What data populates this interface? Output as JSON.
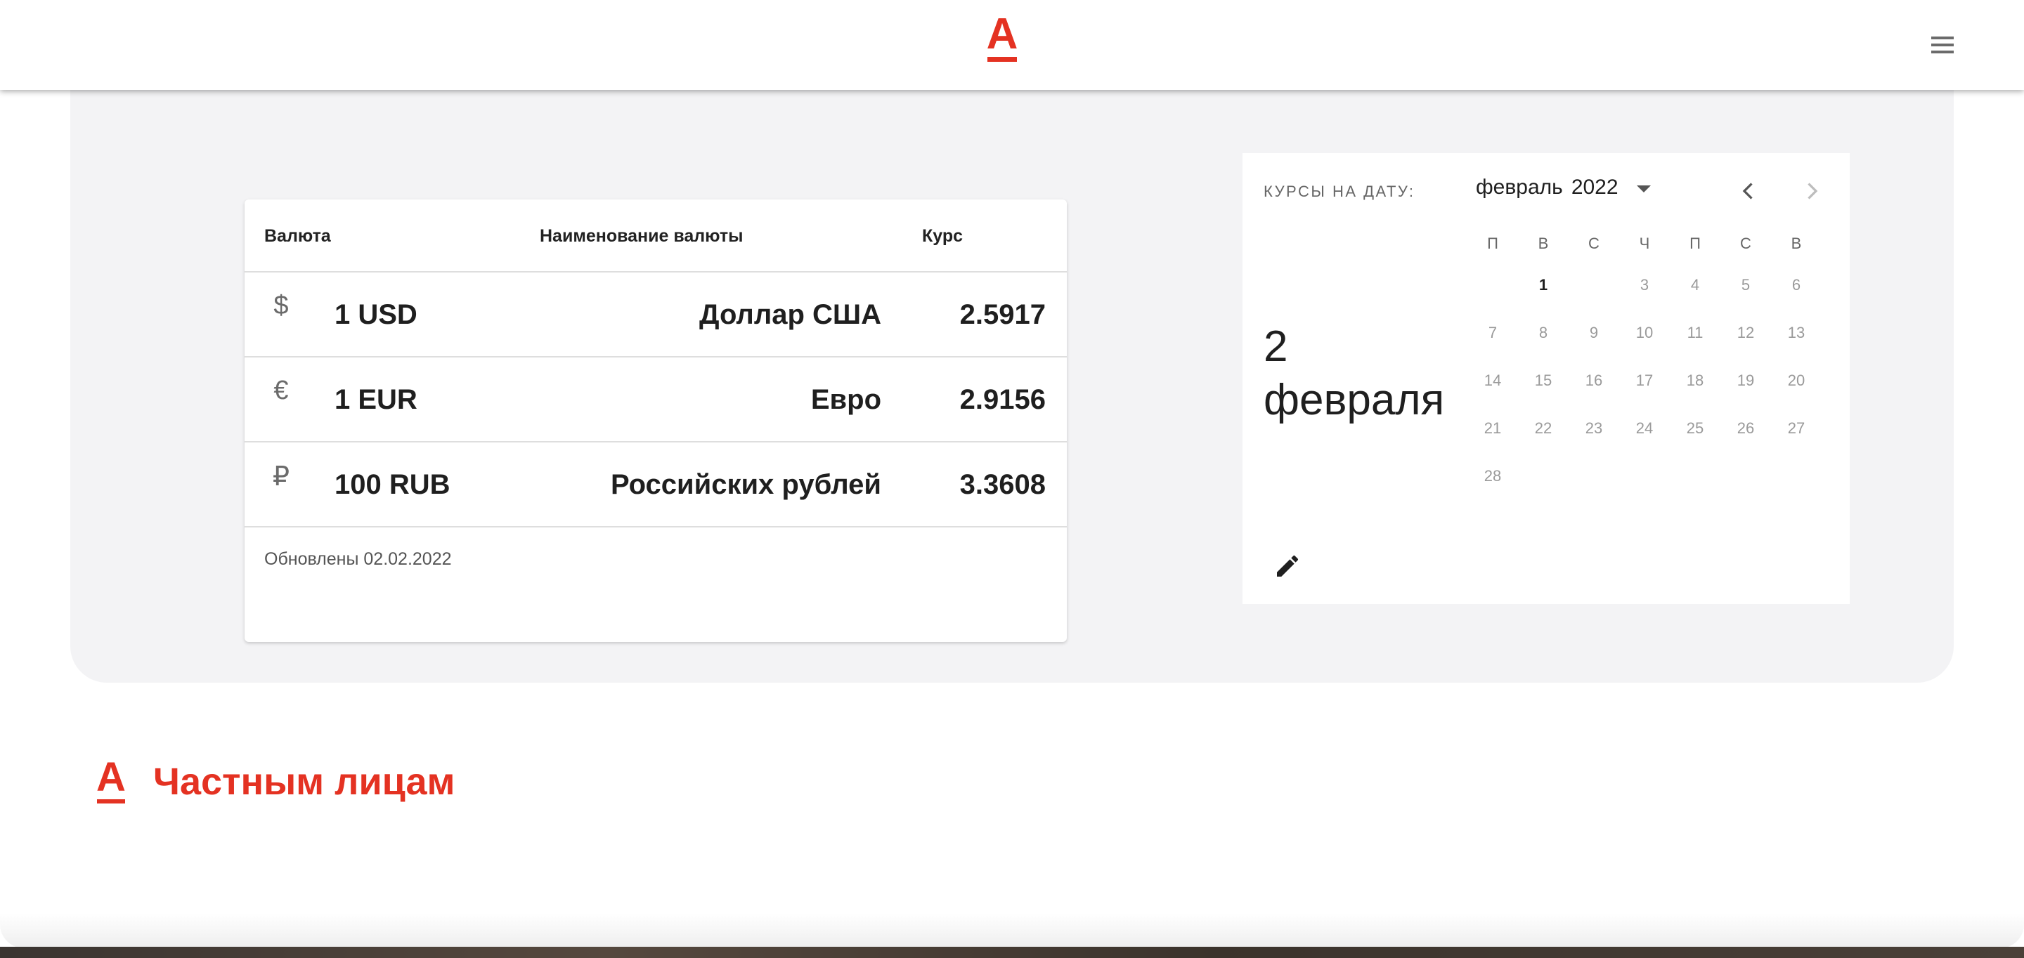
{
  "header": {
    "logo_letter": "А"
  },
  "rates_table": {
    "columns": [
      "Валюта",
      "Наименование валюты",
      "Курс"
    ],
    "rows": [
      {
        "icon": "$",
        "code": "1 USD",
        "name": "Доллар США",
        "rate": "2.5917"
      },
      {
        "icon": "€",
        "code": "1 EUR",
        "name": "Евро",
        "rate": "2.9156"
      },
      {
        "icon": "₽",
        "code": "100 RUB",
        "name": "Российских рублей",
        "rate": "3.3608"
      }
    ],
    "updated": "Обновлены 02.02.2022"
  },
  "date_picker": {
    "label": "КУРСЫ НА ДАТУ:",
    "selected_day": "2",
    "selected_month": "февраля",
    "month": "февраль",
    "year": "2022",
    "weekdays": [
      "П",
      "В",
      "С",
      "Ч",
      "П",
      "С",
      "В"
    ],
    "days": [
      {
        "n": "1",
        "col": 1,
        "row": 0,
        "active": true
      },
      {
        "n": "3",
        "col": 3,
        "row": 0
      },
      {
        "n": "4",
        "col": 4,
        "row": 0
      },
      {
        "n": "5",
        "col": 5,
        "row": 0
      },
      {
        "n": "6",
        "col": 6,
        "row": 0
      },
      {
        "n": "7",
        "col": 0,
        "row": 1
      },
      {
        "n": "8",
        "col": 1,
        "row": 1
      },
      {
        "n": "9",
        "col": 2,
        "row": 1
      },
      {
        "n": "10",
        "col": 3,
        "row": 1
      },
      {
        "n": "11",
        "col": 4,
        "row": 1
      },
      {
        "n": "12",
        "col": 5,
        "row": 1
      },
      {
        "n": "13",
        "col": 6,
        "row": 1
      },
      {
        "n": "14",
        "col": 0,
        "row": 2
      },
      {
        "n": "15",
        "col": 1,
        "row": 2
      },
      {
        "n": "16",
        "col": 2,
        "row": 2
      },
      {
        "n": "17",
        "col": 3,
        "row": 2
      },
      {
        "n": "18",
        "col": 4,
        "row": 2
      },
      {
        "n": "19",
        "col": 5,
        "row": 2
      },
      {
        "n": "20",
        "col": 6,
        "row": 2
      },
      {
        "n": "21",
        "col": 0,
        "row": 3
      },
      {
        "n": "22",
        "col": 1,
        "row": 3
      },
      {
        "n": "23",
        "col": 2,
        "row": 3
      },
      {
        "n": "24",
        "col": 3,
        "row": 3
      },
      {
        "n": "25",
        "col": 4,
        "row": 3
      },
      {
        "n": "26",
        "col": 5,
        "row": 3
      },
      {
        "n": "27",
        "col": 6,
        "row": 3
      },
      {
        "n": "28",
        "col": 0,
        "row": 4
      }
    ]
  },
  "section": {
    "logo_letter": "А",
    "title": "Частным лицам"
  },
  "colors": {
    "brand": "#e43222",
    "panel": "#f3f3f5"
  }
}
